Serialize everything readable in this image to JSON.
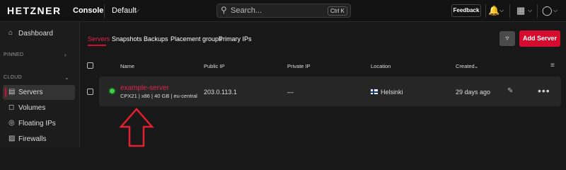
{
  "header": {
    "brand": "HETZNER",
    "brand_sub": "Console",
    "project": "Default",
    "search_placeholder": "Search...",
    "search_shortcut": "Ctrl K",
    "feedback_label": "Feedback"
  },
  "sidebar": {
    "dashboard": "Dashboard",
    "pinned_label": "PINNED",
    "cloud_label": "CLOUD",
    "items": [
      {
        "label": "Servers",
        "icon": "server-icon"
      },
      {
        "label": "Volumes",
        "icon": "volume-icon"
      },
      {
        "label": "Floating IPs",
        "icon": "floating-ip-icon"
      },
      {
        "label": "Firewalls",
        "icon": "firewall-icon"
      }
    ]
  },
  "tabs": [
    "Servers",
    "Snapshots",
    "Backups",
    "Placement groups",
    "Primary IPs"
  ],
  "add_server_label": "Add Server",
  "table": {
    "headers": {
      "name": "Name",
      "public_ip": "Public IP",
      "private_ip": "Private IP",
      "location": "Location",
      "created": "Created"
    },
    "rows": [
      {
        "name": "example-server",
        "meta": "CPX21 | x86 | 40 GB | eu-central",
        "public_ip": "203.0.113.1",
        "private_ip": "—",
        "location": "Helsinki",
        "created": "29 days ago",
        "status_color": "#3ecf4b"
      }
    ]
  },
  "colors": {
    "accent": "#d50c2d",
    "background": "#181818"
  }
}
